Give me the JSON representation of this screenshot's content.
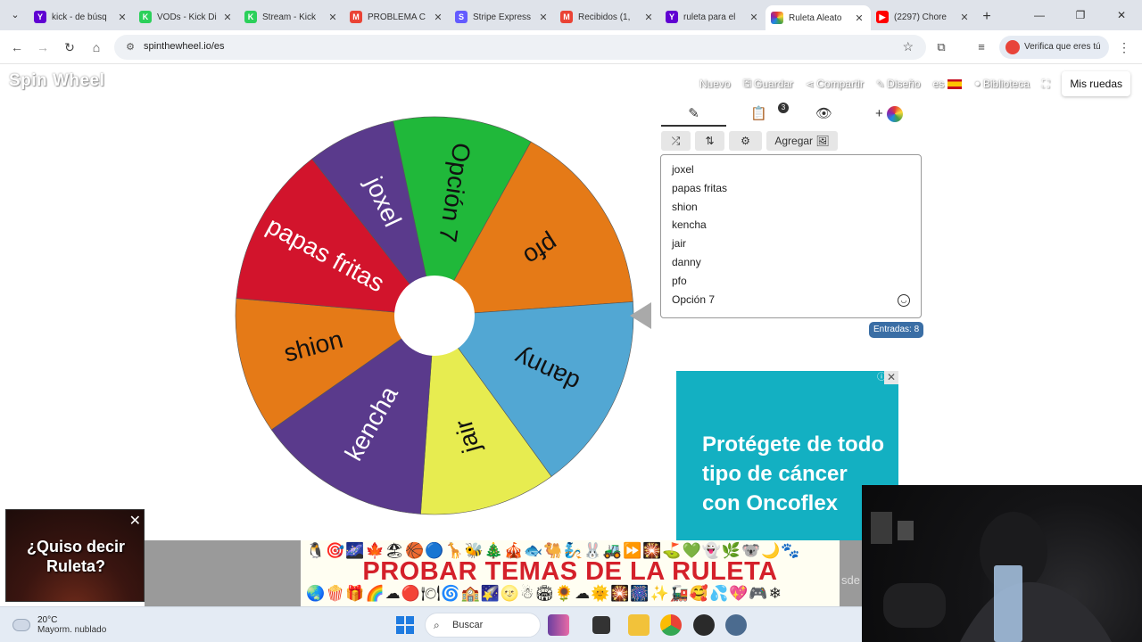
{
  "browser": {
    "tabs": [
      {
        "label": "kick - de búsq",
        "fav": "Y",
        "color": "#6001d2"
      },
      {
        "label": "VODs - Kick Di",
        "fav": "K",
        "color": "#2bd05a"
      },
      {
        "label": "Stream - Kick",
        "fav": "K",
        "color": "#2bd05a"
      },
      {
        "label": "PROBLEMA C",
        "fav": "M",
        "color": "#ea4335"
      },
      {
        "label": "Stripe Express",
        "fav": "S",
        "color": "#635bff"
      },
      {
        "label": "Recibidos (1,",
        "fav": "M",
        "color": "#ea4335"
      },
      {
        "label": "ruleta para el",
        "fav": "Y",
        "color": "#6001d2"
      },
      {
        "label": "Ruleta Aleato",
        "fav": "",
        "color": "#ffffff"
      },
      {
        "label": "(2297) Chore",
        "fav": "▶",
        "color": "#ff0000"
      }
    ],
    "url": "spinthewheel.io/es",
    "profile_label": "Verifica que eres tú"
  },
  "site": {
    "logo": "Spin Wheel",
    "nav": [
      {
        "label": "Nuevo",
        "icon": ""
      },
      {
        "label": "Guardar",
        "icon": "💾"
      },
      {
        "label": "Compartir",
        "icon": "⋖"
      },
      {
        "label": "Diseño",
        "icon": "✎"
      },
      {
        "label": "es",
        "icon": ""
      },
      {
        "label": "Biblioteca",
        "icon": "●"
      }
    ],
    "my_wheels": "Mis ruedas"
  },
  "wheel": {
    "segments": [
      {
        "label": "Opción 7",
        "color": "#20b83a",
        "start": -12,
        "end": 29
      },
      {
        "label": "pfo",
        "color": "#e57a17",
        "start": 29,
        "end": 86
      },
      {
        "label": "danny",
        "color": "#52a7d3",
        "start": 86,
        "end": 144
      },
      {
        "label": "jair",
        "color": "#e7ec50",
        "start": 144,
        "end": 184
      },
      {
        "label": "kencha",
        "color": "#5a3a8c",
        "start": 184,
        "end": 235
      },
      {
        "label": "shion",
        "color": "#e57a17",
        "start": 235,
        "end": 275
      },
      {
        "label": "papas fritas",
        "color": "#d2142c",
        "start": 275,
        "end": 322
      },
      {
        "label": "joxel",
        "color": "#5a3a8c",
        "start": 322,
        "end": 348
      }
    ]
  },
  "editor": {
    "tabs": [
      "✎",
      "📋",
      "👁",
      "+"
    ],
    "results_badge": "3",
    "actions": [
      "⤮",
      "⇅",
      "⚙",
      "Agregar 🖼"
    ],
    "entries": [
      "joxel",
      "papas fritas",
      "shion",
      "kencha",
      "jair",
      "danny",
      "pfo",
      "Opción 7"
    ],
    "count_label": "Entradas: 8"
  },
  "ad": {
    "text": "Protégete de todo tipo de cáncer con Oncoflex",
    "info": "ⓘ",
    "close": "✕"
  },
  "promo": {
    "title": "PROBAR TEMAS DE LA RULETA",
    "emoji_top": "🐧🎯🌌🍁🏖🏀🔵🦒🐝🎄🎪🐟🐫🧞🐰🚜⏩🎇⛳💚👻🌿🐨🌙🐾",
    "emoji_bottom": "🌏🍿🎁🌈☁🔴🍽🌀🏫🌠🌝☃🏟🌻☁🌞🎇🎆✨🚂🥰💦💖🎮❄",
    "side_text": "sde"
  },
  "popup": {
    "question": "¿Quiso decir Ruleta?",
    "close": "✕"
  },
  "taskbar": {
    "temp": "20°C",
    "weather": "Mayorm. nublado",
    "search": "Buscar"
  }
}
